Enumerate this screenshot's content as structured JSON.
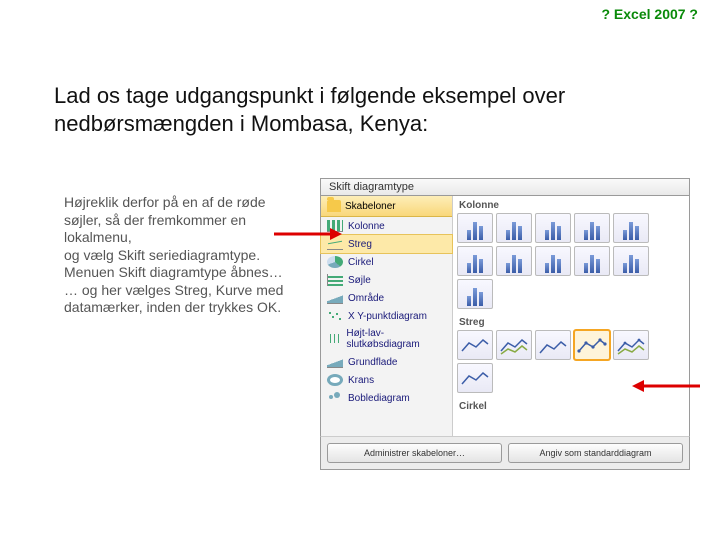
{
  "header": {
    "link": "? Excel 2007 ?"
  },
  "heading": "Lad os tage udgangspunkt i følgende eksempel over nedbørsmængden i Mombasa, Kenya:",
  "instructions": {
    "l1": "Højreklik derfor på en af de røde søjler, så der fremkommer en lokalmenu,",
    "l2": "og vælg Skift seriediagramtype.",
    "l3": "Menuen Skift diagramtype åbnes…",
    "l4": "… og her vælges Streg, Kurve med datamærker, inden der trykkes OK."
  },
  "dialog": {
    "title": "Skift diagramtype",
    "templates_label": "Skabeloner",
    "categories": [
      {
        "label": "Kolonne"
      },
      {
        "label": "Streg"
      },
      {
        "label": "Cirkel"
      },
      {
        "label": "Søjle"
      },
      {
        "label": "Område"
      },
      {
        "label": "X Y-punktdiagram"
      },
      {
        "label": "Højt-lav-slutkøbsdiagram"
      },
      {
        "label": "Grundflade"
      },
      {
        "label": "Krans"
      },
      {
        "label": "Boblediagram"
      }
    ],
    "selected_category_index": 1,
    "sections": {
      "kolonne": "Kolonne",
      "streg": "Streg",
      "cirkel": "Cirkel"
    },
    "buttons": {
      "manage": "Administrer skabeloner…",
      "set_default": "Angiv som standarddiagram"
    }
  }
}
